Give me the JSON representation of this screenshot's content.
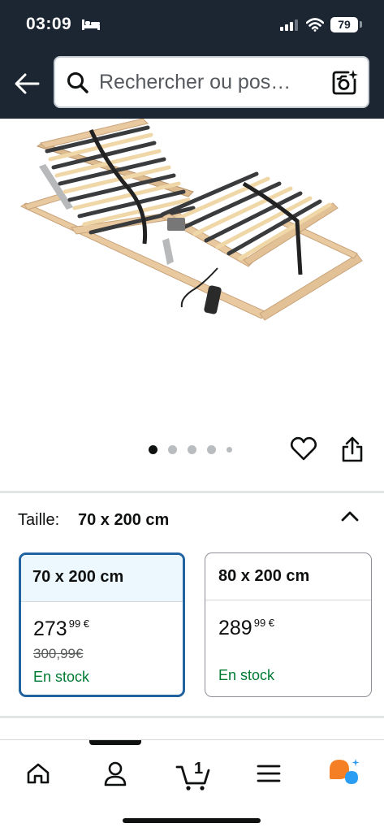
{
  "status_bar": {
    "time": "03:09",
    "battery": "79"
  },
  "header": {
    "search_placeholder": "Rechercher ou pos…"
  },
  "carousel": {
    "dot_count": 5,
    "active_index": 0
  },
  "size_selector": {
    "label": "Taille:",
    "selected_value": "70 x 200 cm",
    "options": [
      {
        "name": "70 x 200 cm",
        "price_whole": "273",
        "price_fraction": "99 €",
        "old_price": "300,99€",
        "availability": "En stock",
        "selected": true
      },
      {
        "name": "80 x 200 cm",
        "price_whole": "289",
        "price_fraction": "99 €",
        "old_price": "",
        "availability": "En stock",
        "selected": false
      }
    ]
  },
  "bottom_nav": {
    "cart_count": "1",
    "items": [
      "home-icon",
      "account-icon",
      "cart-icon",
      "menu-icon",
      "rufus-icon"
    ]
  },
  "colors": {
    "header_bg": "#1c2633",
    "selected_border": "#2162a1",
    "selected_head_bg": "#edf7fe",
    "in_stock": "#007a33",
    "rufus_orange": "#f57f24",
    "rufus_blue": "#2b9ef3"
  }
}
